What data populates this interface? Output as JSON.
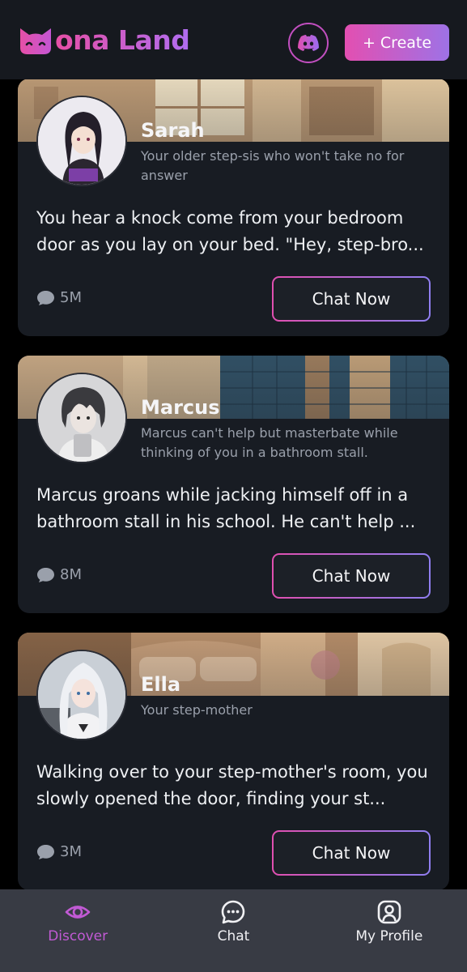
{
  "header": {
    "logo_text": "ona Land",
    "create_label": "+ Create"
  },
  "cards": [
    {
      "name": "Sarah",
      "tagline": "Your older step-sis who won't take no for answer",
      "description": "You hear a knock come from your bedroom door as you lay on your bed. \"Hey, step-bro...",
      "chats": "5M",
      "button_label": "Chat Now"
    },
    {
      "name": "Marcus",
      "tagline": "Marcus can't help but masterbate while thinking of you in a bathroom stall.",
      "description": "Marcus groans while jacking himself off in a bathroom stall in his school. He can't help ...",
      "chats": "8M",
      "button_label": "Chat Now"
    },
    {
      "name": "Ella",
      "tagline": "Your step-mother",
      "description": "Walking over to your step-mother's room, you slowly opened the door, finding your st...",
      "chats": "3M",
      "button_label": "Chat Now"
    }
  ],
  "nav": {
    "discover": "Discover",
    "chat": "Chat",
    "profile": "My Profile"
  },
  "colors": {
    "accent_pink": "#e34fb1",
    "accent_purple": "#9e72e6",
    "active_nav": "#c15ad4"
  }
}
